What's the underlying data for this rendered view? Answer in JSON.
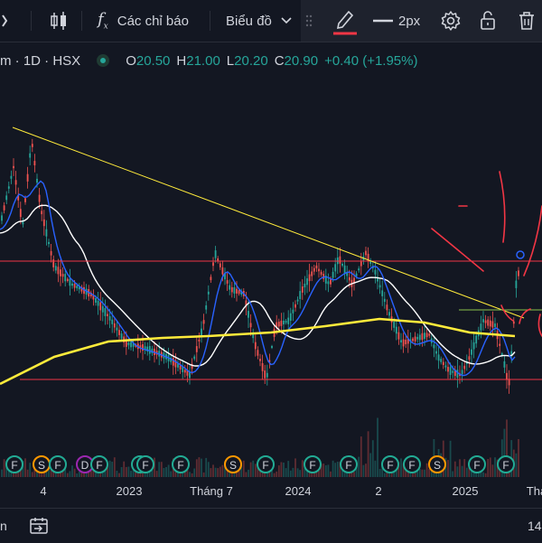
{
  "toolbar": {
    "indicators_label": "Các chỉ báo",
    "chart_type_label": "Biểu đồ",
    "line_width_label": "2px"
  },
  "legend": {
    "symbol": "m · 1D · HSX",
    "open_key": "O",
    "open": "20.50",
    "high_key": "H",
    "high": "21.00",
    "low_key": "L",
    "low": "20.20",
    "close_key": "C",
    "close": "20.90",
    "change": "+0.40 (+1.95%)"
  },
  "xaxis": {
    "labels": [
      "4",
      "2023",
      "Tháng 7",
      "2024",
      "2",
      "2025",
      "Thá"
    ]
  },
  "bottom": {
    "left_text": "n",
    "right_text": "14"
  },
  "events": [
    "F",
    "S",
    "F",
    "D",
    "F",
    "F",
    "F",
    "F",
    "S",
    "F",
    "F",
    "F",
    "F",
    "F",
    "S",
    "F",
    "F"
  ],
  "colors": {
    "background": "#131722",
    "up": "#26a69a",
    "down": "#ef5350",
    "ma_blue": "#2962ff",
    "ma_white": "#ffffff",
    "ma_yellow": "#ffeb3b",
    "annotation_red": "#f23645",
    "event_green": "#22ab94",
    "event_orange": "#ff9800",
    "event_purple": "#9c27b0"
  },
  "icons": [
    "candle-icon",
    "function-icon",
    "chevron-down-icon",
    "pencil-icon",
    "line-width-icon",
    "gear-icon",
    "lock-icon",
    "trash-icon",
    "calendar-icon",
    "grid-handle-icon"
  ]
}
